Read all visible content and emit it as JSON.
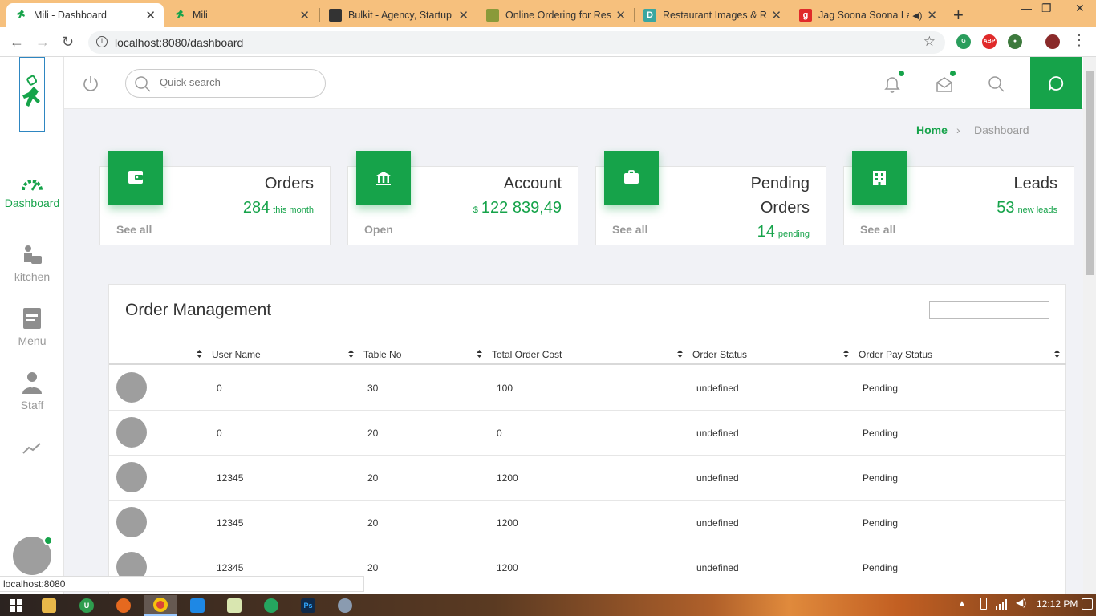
{
  "browser": {
    "tabs": [
      {
        "title": "Mili - Dashboard",
        "favicon": "runner-logo-icon",
        "active": true
      },
      {
        "title": "Mili",
        "favicon": "runner-logo-icon",
        "active": false
      },
      {
        "title": "Bulkit - Agency, Startup a",
        "favicon": "bulkit-icon",
        "active": false
      },
      {
        "title": "Online Ordering for Rest",
        "favicon": "orders-icon",
        "active": false
      },
      {
        "title": "Restaurant Images & Re",
        "favicon": "d-icon",
        "favicon_letter": "D",
        "active": false
      },
      {
        "title": "Jag Soona Soona La",
        "favicon": "g-icon",
        "favicon_letter": "g",
        "active": false
      }
    ],
    "url": "localhost:8080/dashboard",
    "status_url": "localhost:8080"
  },
  "sidebar": {
    "items": [
      {
        "label": "Dashboard",
        "icon": "speedometer-icon",
        "active": true
      },
      {
        "label": "kitchen",
        "icon": "chef-icon",
        "active": false
      },
      {
        "label": "Menu",
        "icon": "menu-book-icon",
        "active": false
      },
      {
        "label": "Staff",
        "icon": "staff-icon",
        "active": false
      },
      {
        "label": "",
        "icon": "trend-chart-icon",
        "active": false
      }
    ]
  },
  "header": {
    "search_placeholder": "Quick search"
  },
  "breadcrumb": {
    "home": "Home",
    "separator": "›",
    "current": "Dashboard"
  },
  "cards": [
    {
      "title": "Orders",
      "value": "284",
      "unit": "this month",
      "link": "See all",
      "icon": "wallet-icon"
    },
    {
      "title": "Account",
      "currency": "$",
      "value": "122 839,49",
      "link": "Open",
      "icon": "bank-icon"
    },
    {
      "title_line1": "Pending",
      "title_line2": "Orders",
      "value": "14",
      "unit": "pending",
      "link": "See all",
      "icon": "briefcase-icon"
    },
    {
      "title": "Leads",
      "value": "53",
      "unit": "new leads",
      "link": "See all",
      "icon": "building-icon"
    }
  ],
  "orders": {
    "title": "Order Management",
    "columns": [
      "User Name",
      "Table No",
      "Total Order Cost",
      "Order Status",
      "Order Pay Status"
    ],
    "rows": [
      {
        "user": "0",
        "table": "30",
        "cost": "100",
        "status": "undefined",
        "pay": "Pending"
      },
      {
        "user": "0",
        "table": "20",
        "cost": "0",
        "status": "undefined",
        "pay": "Pending"
      },
      {
        "user": "12345",
        "table": "20",
        "cost": "1200",
        "status": "undefined",
        "pay": "Pending"
      },
      {
        "user": "12345",
        "table": "20",
        "cost": "1200",
        "status": "undefined",
        "pay": "Pending"
      },
      {
        "user": "12345",
        "table": "20",
        "cost": "1200",
        "status": "undefined",
        "pay": "Pending"
      }
    ]
  },
  "taskbar": {
    "time": "12:12 PM",
    "apps": [
      "start-icon",
      "file-explorer-icon",
      "upwork-icon",
      "firefox-icon",
      "chrome-icon",
      "vscode-icon",
      "notepad-icon",
      "whatsapp-icon",
      "photoshop-icon",
      "paint-icon"
    ]
  },
  "colors": {
    "accent": "#16a34a",
    "tab_strip": "#f6c07d",
    "background": "#f1f2f6"
  }
}
